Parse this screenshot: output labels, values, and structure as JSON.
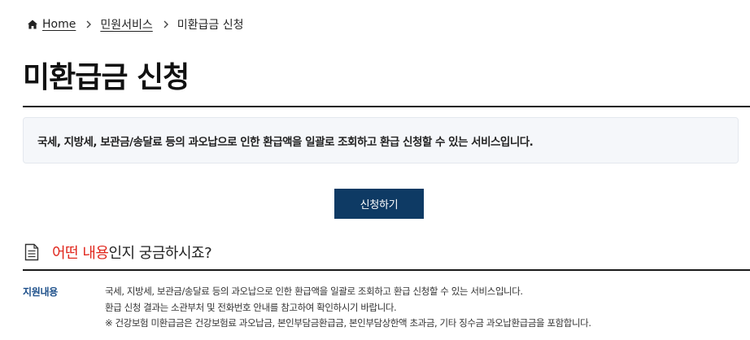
{
  "breadcrumb": {
    "home": "Home",
    "level1": "민원서비스",
    "current": "미환급금 신청"
  },
  "page": {
    "title": "미환급금 신청",
    "summary": "국세, 지방세, 보관금/송달료 등의 과오납으로 인한 환급액을 일괄로 조회하고 환급 신청할 수 있는 서비스입니다."
  },
  "actions": {
    "apply_label": "신청하기"
  },
  "section": {
    "heading_accent": "어떤 내용",
    "heading_rest": "인지 궁금하시죠?",
    "label": "지원내용",
    "lines": [
      "국세, 지방세, 보관금/송달료 등의 과오납으로 인한 환급액을 일괄로 조회하고 환급 신청할 수 있는 서비스입니다.",
      "환급 신청 결과는 소관부처 및 전화번호 안내를 참고하여 확인하시기 바랍니다.",
      "※ 건강보험 미환급금은 건강보험료 과오납금, 본인부담금환급금, 본인부담상한액 초과금, 기타 징수금 과오납환급금을 포함합니다."
    ]
  },
  "colors": {
    "button_bg": "#0e3a64",
    "accent_red": "#e0271d",
    "label_blue": "#1c4f8a"
  },
  "icons": [
    "home-icon",
    "chevron-right-icon",
    "document-icon"
  ]
}
